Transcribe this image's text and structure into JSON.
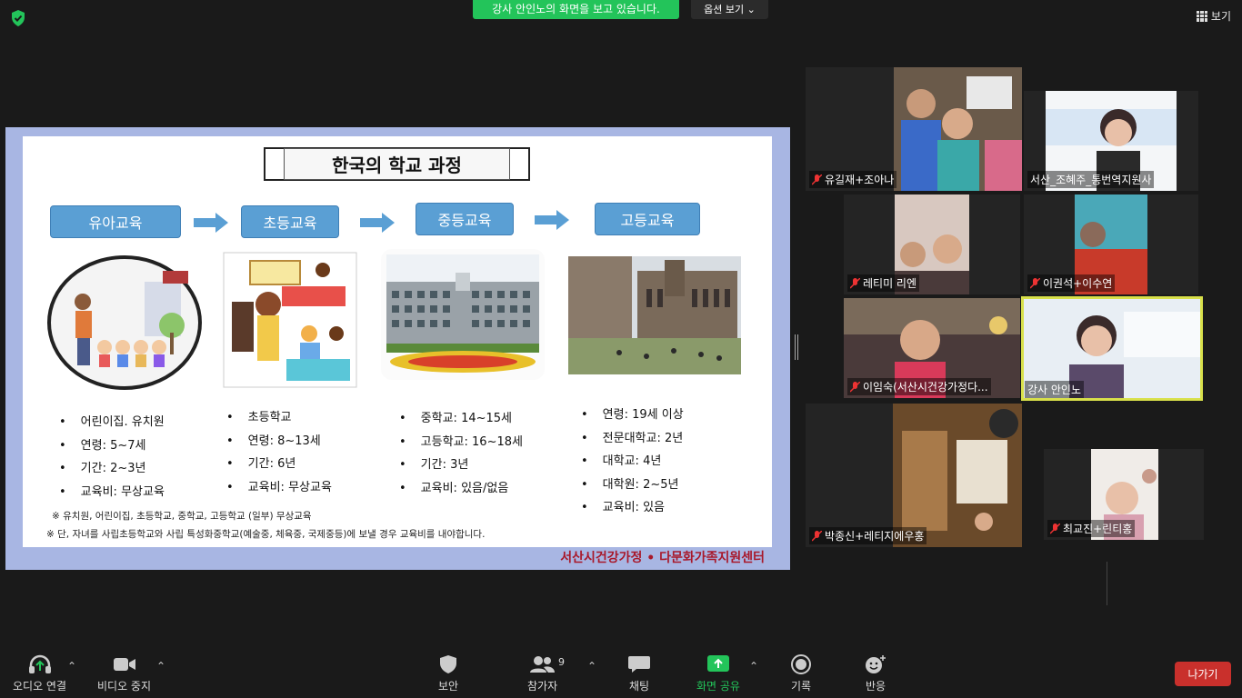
{
  "top": {
    "share_banner": "강사 안인노의 화면을 보고 있습니다.",
    "view_options": "옵션 보기 ⌄",
    "view_label": "보기"
  },
  "slide": {
    "title": "한국의 학교 과정",
    "stages": [
      "유아교육",
      "초등교육",
      "중등교육",
      "고등교육"
    ],
    "col1": [
      "어린이집. 유치원",
      "연령: 5~7세",
      "기간: 2~3년",
      "교육비: 무상교육"
    ],
    "col2": [
      "초등학교",
      "연령:  8~13세",
      "기간: 6년",
      "교육비: 무상교육"
    ],
    "col3": [
      "중학교:  14~15세",
      "고등학교: 16~18세",
      "기간: 3년",
      "교육비: 있음/없음"
    ],
    "col4": [
      "연령: 19세 이상",
      "전문대학교: 2년",
      "대학교: 4년",
      "대학원: 2~5년",
      "교육비: 있음"
    ],
    "note1": "※ 유치원, 어린이집, 초등학교, 중학교, 고등학교 (일부) 무상교육",
    "note2": "※ 단, 자녀를 사립초등학교와 사립 특성화중학교(예술중, 체육중, 국제중등)에 보낼 경우 교육비를 내야합니다.",
    "brand": "서산시건강가정 • 다문화가족지원센터"
  },
  "participants": [
    {
      "name": "유길재+조아나"
    },
    {
      "name": "서산_조혜주_통번역지원사"
    },
    {
      "name": "레티미 리엔"
    },
    {
      "name": "이권석+이수연"
    },
    {
      "name": "이임숙(서산시건강가정다..."
    },
    {
      "name": "강사 안인노"
    },
    {
      "name": "박종신+레티지에우홍"
    },
    {
      "name": "최교진+린티홍"
    }
  ],
  "toolbar": {
    "audio": "오디오 연결",
    "video": "비디오 중지",
    "security": "보안",
    "participants": "참가자",
    "participant_count": "9",
    "chat": "채팅",
    "share": "화면 공유",
    "record": "기록",
    "reactions": "반응",
    "leave": "나가기"
  },
  "colors": {
    "share_green": "#23c45a",
    "leave_red": "#c9302c",
    "active_speaker": "#d8e04a",
    "stage_blue": "#5a9fd4"
  }
}
